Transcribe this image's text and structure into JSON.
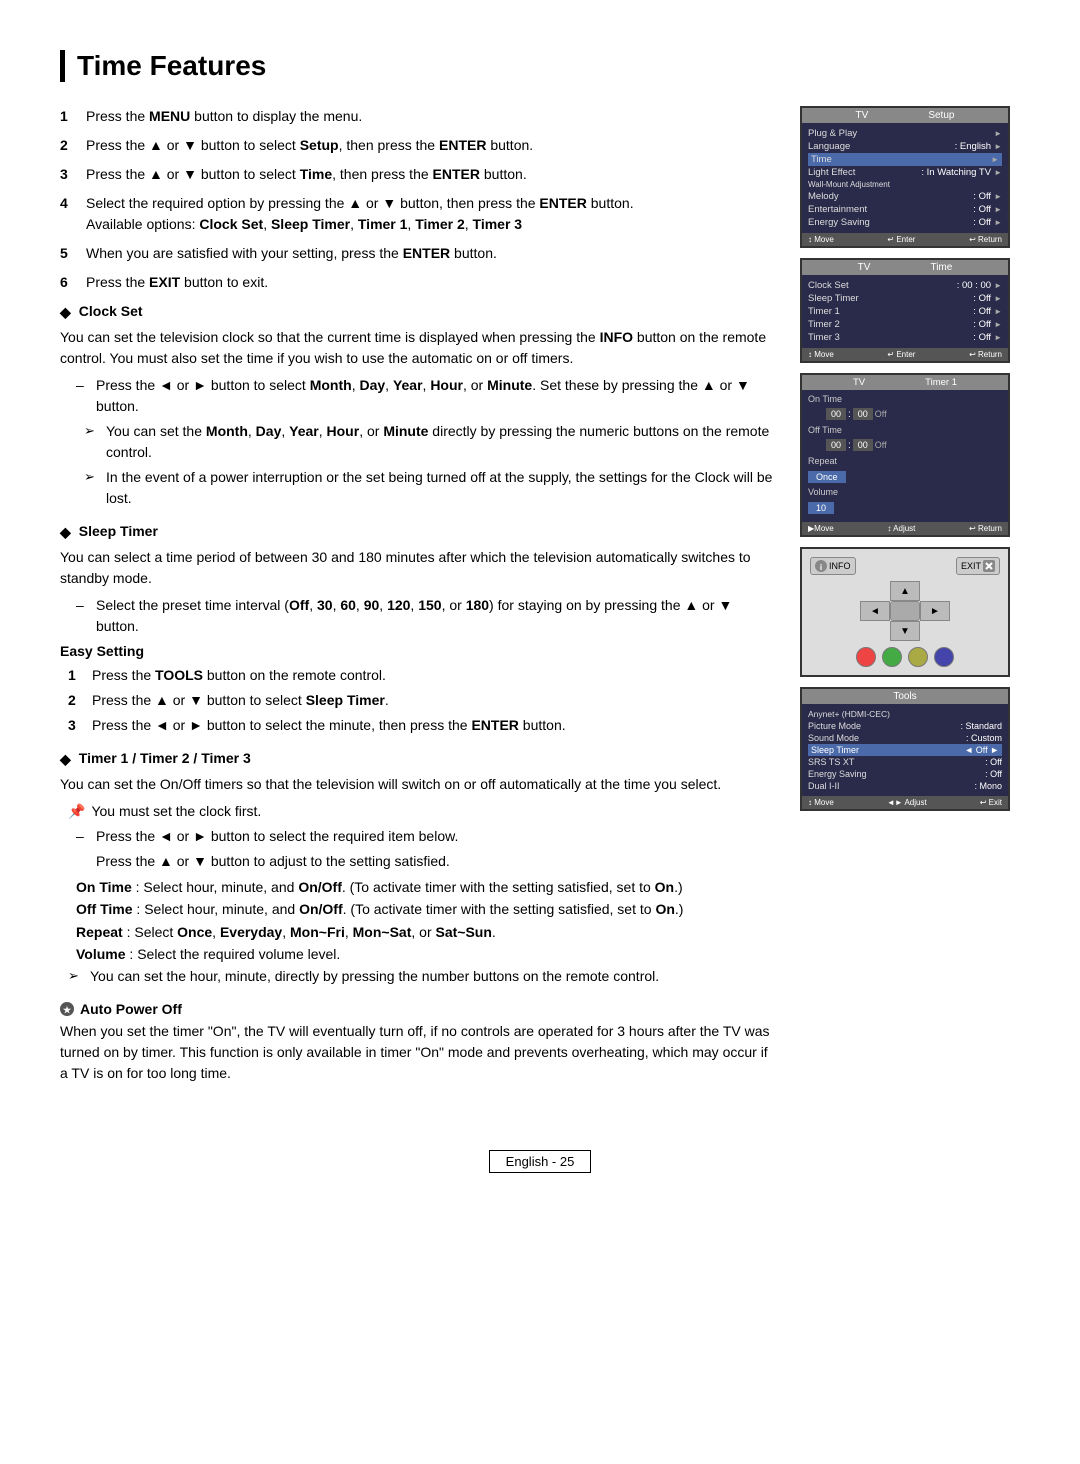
{
  "title": "Time Features",
  "steps": [
    {
      "number": "1",
      "text": "Press the ",
      "bold": "MENU",
      "rest": " button to display the menu."
    },
    {
      "number": "2",
      "text": "Press the ▲ or ▼ button to select ",
      "bold": "Setup",
      "rest": ", then press the ",
      "bold2": "ENTER",
      "rest2": " button."
    },
    {
      "number": "3",
      "text": "Press the ▲ or ▼ button to select ",
      "bold": "Time",
      "rest": ", then press the ",
      "bold2": "ENTER",
      "rest2": " button."
    },
    {
      "number": "4",
      "text": "Select the required option by pressing the ▲ or ▼ button, then press the ENTER button.",
      "sub": "Available options: Clock Set, Sleep Timer, Timer 1, Timer 2, Timer 3"
    },
    {
      "number": "5",
      "text": "When you are satisfied with your setting, press the ",
      "bold": "ENTER",
      "rest": " button."
    },
    {
      "number": "6",
      "text": "Press the ",
      "bold": "EXIT",
      "rest": " button to exit."
    }
  ],
  "sections": {
    "clock_set": {
      "title": "Clock Set",
      "body": "You can set the television clock so that the current time is displayed when pressing the INFO button on the remote control. You must also set the time if you wish to use the automatic on or off timers.",
      "bullets": [
        "Press the ◄ or ► button to select Month, Day, Year, Hour, or Minute. Set these by pressing the ▲ or ▼ button.",
        "You can set the Month, Day, Year, Hour, or Minute directly by pressing the numeric buttons on the remote control.",
        "In the event of a power interruption or the set being turned off at the supply, the settings for the Clock will be lost."
      ]
    },
    "sleep_timer": {
      "title": "Sleep Timer",
      "body": "You can select a time period of between 30 and 180 minutes after which the television automatically switches to standby mode.",
      "bullet": "Select the preset time interval (Off, 30, 60, 90, 120, 150, or 180) for staying on by pressing the ▲ or ▼ button.",
      "easy_setting": {
        "header": "Easy Setting",
        "steps": [
          {
            "n": "1",
            "text": "Press the TOOLS button on the remote control."
          },
          {
            "n": "2",
            "text": "Press the ▲ or ▼ button to select Sleep Timer."
          },
          {
            "n": "3",
            "text": "Press the ◄ or ► button to select the minute, then press the ENTER button."
          }
        ]
      }
    },
    "timer": {
      "title": "Timer 1 / Timer 2 / Timer 3",
      "body": "You can set the On/Off timers so that the television will switch on or off automatically at the time you select.",
      "note": "You must set the clock first.",
      "bullets": [
        "Press the ◄ or ► button to select the required item below.",
        "Press the ▲ or ▼ button to adjust to the setting satisfied."
      ],
      "on_time": "On Time : Select hour, minute, and On/Off. (To activate timer with the setting satisfied, set to On.)",
      "off_time": "Off Time : Select hour, minute, and On/Off. (To activate timer with the setting satisfied, set to On.)",
      "repeat": "Repeat : Select Once, Everyday, Mon~Fri, Mon~Sat, or Sat~Sun.",
      "volume": "Volume : Select the required volume level.",
      "arrow": "You can set the hour, minute, directly by pressing the number buttons on the remote control."
    },
    "auto_power": {
      "title": "Auto Power Off",
      "body": "When you set the timer \"On\", the TV will eventually turn off, if no controls are operated for 3 hours after the TV was turned on by timer. This function is only available in timer \"On\" mode and prevents overheating, which may occur if a TV is on for too long time."
    }
  },
  "setup_panel": {
    "tv_label": "TV",
    "header": "Setup",
    "rows": [
      {
        "label": "Plug & Play",
        "value": "",
        "arrow": true
      },
      {
        "label": "Language",
        "value": ": English",
        "arrow": true
      },
      {
        "label": "Time",
        "value": "",
        "arrow": true,
        "highlighted": true
      },
      {
        "label": "Light Effect",
        "value": ": In Watching TV",
        "arrow": true
      },
      {
        "label": "Wall-Mount Adjustment",
        "value": "",
        "arrow": false
      },
      {
        "label": "Melody",
        "value": ": Off",
        "arrow": true
      },
      {
        "label": "Entertainment",
        "value": ": Off",
        "arrow": true
      },
      {
        "label": "Energy Saving",
        "value": ": Off",
        "arrow": true
      }
    ],
    "footer": [
      "↕ Move",
      "↵ Enter",
      "↩ Return"
    ]
  },
  "time_panel": {
    "tv_label": "TV",
    "header": "Time",
    "rows": [
      {
        "label": "Clock Set",
        "value": ": 00 : 00",
        "arrow": true
      },
      {
        "label": "Sleep Timer",
        "value": ": Off",
        "arrow": true
      },
      {
        "label": "Timer 1",
        "value": ": Off",
        "arrow": true
      },
      {
        "label": "Timer 2",
        "value": ": Off",
        "arrow": true
      },
      {
        "label": "Timer 3",
        "value": ": Off",
        "arrow": true
      }
    ],
    "footer": [
      "↕ Move",
      "↵ Enter",
      "↩ Return"
    ]
  },
  "timer1_panel": {
    "tv_label": "TV",
    "header": "Timer 1",
    "on_time": {
      "h": "00",
      "m": "00",
      "status": "Off"
    },
    "off_time": {
      "h": "00",
      "m": "00",
      "status": "Off"
    },
    "repeat": "Once",
    "volume": "10",
    "footer": [
      "▶Move",
      "↕ Adjust",
      "↩ Return"
    ]
  },
  "tools_panel": {
    "header": "Tools",
    "rows": [
      {
        "label": "Anynet+ (HDMI-CEC)",
        "value": "",
        "arrow": false
      },
      {
        "label": "Picture Mode",
        "value": ": Standard",
        "arrow": false
      },
      {
        "label": "Sound Mode",
        "value": ": Custom",
        "arrow": false
      },
      {
        "label": "Sleep Timer",
        "value": "◄ Off ►",
        "highlighted": true
      },
      {
        "label": "SRS TS XT",
        "value": ": Off",
        "arrow": false
      },
      {
        "label": "Energy Saving",
        "value": ": Off",
        "arrow": false
      },
      {
        "label": "Dual I-II",
        "value": ": Mono",
        "arrow": false
      }
    ],
    "footer": [
      "↕ Move",
      "◄► Adjust",
      "↩ Exit"
    ]
  },
  "footer": {
    "label": "English - 25"
  }
}
